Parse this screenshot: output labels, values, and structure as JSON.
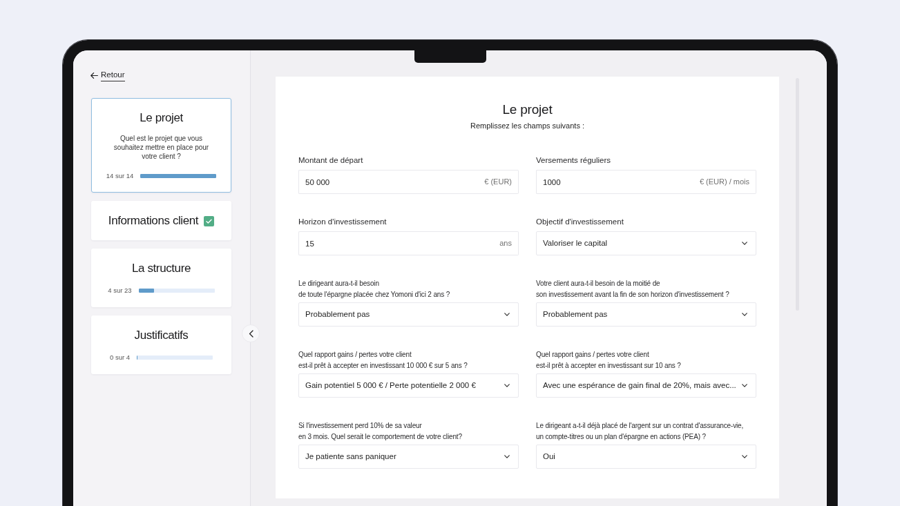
{
  "back_link": {
    "label": "Retour"
  },
  "steps": [
    {
      "title": "Le projet",
      "description": "Quel est le projet que vous souhaitez mettre en place pour votre client ?",
      "count": "14 sur 14",
      "level": 1,
      "completed": false,
      "selected": true
    },
    {
      "title": "Informations client",
      "completed": true,
      "selected": false
    },
    {
      "title": "La structure",
      "count": "4 sur 23",
      "level": 0.2,
      "completed": false,
      "selected": false
    },
    {
      "title": "Justificatifs",
      "count": "0 sur 4",
      "level": 0,
      "completed": false,
      "selected": false
    }
  ],
  "form": {
    "title": "Le projet",
    "subtitle": "Remplissez les champs suivants :",
    "fields": [
      {
        "kind": "amount",
        "label": [
          "Montant de départ"
        ],
        "value": "50 000",
        "unit": "€ (EUR)"
      },
      {
        "kind": "amount",
        "label": [
          "Versements réguliers"
        ],
        "value": "1000",
        "unit": "€ (EUR) / mois"
      },
      {
        "kind": "amount",
        "label": [
          "Horizon d'investissement"
        ],
        "value": "15",
        "unit": "ans"
      },
      {
        "kind": "select",
        "label": [
          "Objectif d'investissement"
        ],
        "value": "Valoriser le capital"
      },
      {
        "kind": "select",
        "label": [
          "Le dirigeant aura-t-il besoin",
          "de toute l'épargne placée chez Yomoni d'ici 2 ans ?"
        ],
        "value": "Probablement pas"
      },
      {
        "kind": "select",
        "label": [
          "Votre client aura-t-il besoin de la moitié de",
          "son investissement avant la fin de son horizon d'investissement ?"
        ],
        "value": "Probablement pas"
      },
      {
        "kind": "select",
        "label": [
          "Quel rapport gains / pertes votre client",
          "est-il prêt à accepter en investissant 10 000 € sur 5 ans ?"
        ],
        "value": "Gain potentiel 5 000 € / Perte potentielle 2 000 €"
      },
      {
        "kind": "select",
        "label": [
          "Quel rapport gains / pertes votre client",
          "est-il prêt à accepter en investissant sur 10 ans ?"
        ],
        "value": "Avec une espérance de gain final de 20%, mais avec..."
      },
      {
        "kind": "select",
        "label": [
          "Si l'investissement perd 10% de sa valeur",
          "en 3 mois. Quel serait le comportement de votre client?"
        ],
        "value": "Je patiente sans paniquer"
      },
      {
        "kind": "select",
        "label": [
          "Le dirigeant a-t-il déjà placé de l'argent sur un contrat d'assurance-vie,",
          "un compte-titres ou un plan d'épargne en actions (PEA) ?"
        ],
        "value": "Oui"
      }
    ]
  }
}
